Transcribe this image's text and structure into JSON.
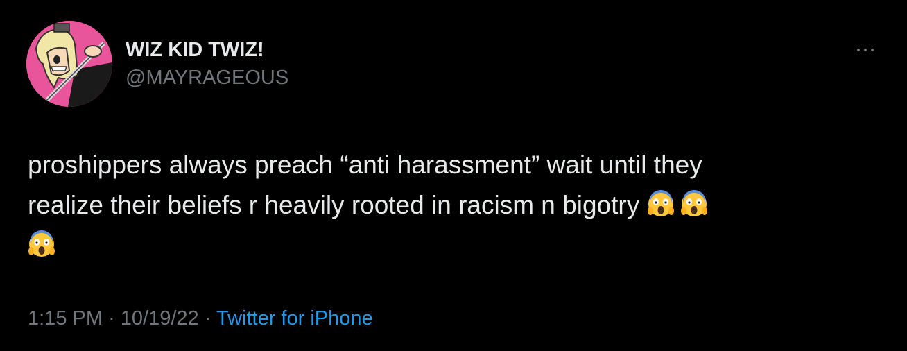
{
  "tweet": {
    "author": {
      "display_name": "WIZ KID TWIZ!",
      "handle": "@MAYRAGEOUS",
      "avatar_icon": "profile-avatar"
    },
    "more_icon": "more-options-icon",
    "text_line1": "proshippers always preach “anti harassment” wait until they",
    "text_line2": "realize their beliefs r heavily rooted in racism n bigotry",
    "emoji_icon": "face-screaming-in-fear-emoji",
    "time": "1:15 PM",
    "date": "10/19/22",
    "separator": "·",
    "source": "Twitter for iPhone"
  },
  "colors": {
    "background": "#000000",
    "primary_text": "#e7e9ea",
    "secondary_text": "#71767b",
    "link": "#1d9bf0",
    "avatar_bg": "#e8559a"
  }
}
